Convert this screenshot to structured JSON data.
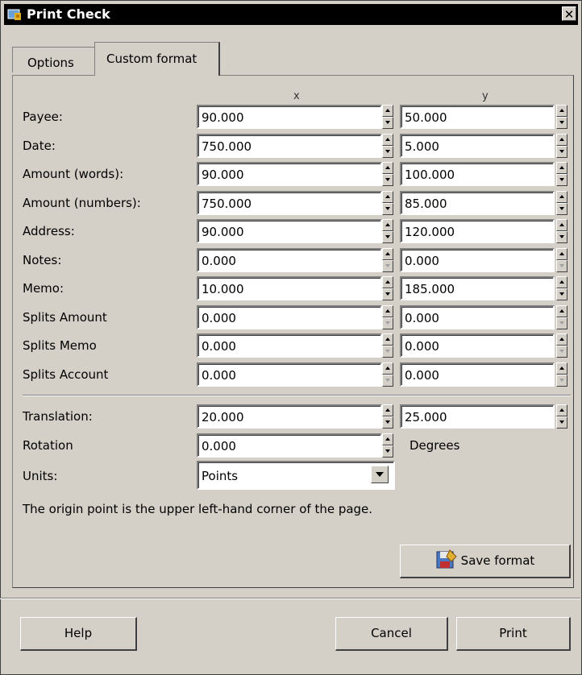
{
  "window": {
    "title": "Print Check",
    "close_glyph": "✕"
  },
  "tabs": [
    {
      "label": "Options"
    },
    {
      "label": "Custom format"
    }
  ],
  "columns": {
    "x": "x",
    "y": "y"
  },
  "rows": [
    {
      "label": "Payee:",
      "x": "90.000",
      "y": "50.000"
    },
    {
      "label": "Date:",
      "x": "750.000",
      "y": "5.000"
    },
    {
      "label": "Amount (words):",
      "x": "90.000",
      "y": "100.000"
    },
    {
      "label": "Amount (numbers):",
      "x": "750.000",
      "y": "85.000"
    },
    {
      "label": "Address:",
      "x": "90.000",
      "y": "120.000"
    },
    {
      "label": "Notes:",
      "x": "0.000",
      "y": "0.000"
    },
    {
      "label": "Memo:",
      "x": "10.000",
      "y": "185.000"
    },
    {
      "label": "Splits Amount",
      "x": "0.000",
      "y": "0.000"
    },
    {
      "label": "Splits Memo",
      "x": "0.000",
      "y": "0.000"
    },
    {
      "label": "Splits Account",
      "x": "0.000",
      "y": "0.000"
    }
  ],
  "translation": {
    "label": "Translation:",
    "x": "20.000",
    "y": "25.000"
  },
  "rotation": {
    "label": "Rotation",
    "value": "0.000",
    "unit": "Degrees"
  },
  "units": {
    "label": "Units:",
    "selected": "Points"
  },
  "note": "The origin point is the upper left-hand corner of the page.",
  "buttons": {
    "save_format": "Save format",
    "help": "Help",
    "cancel": "Cancel",
    "print": "Print"
  },
  "icons": [
    "app-icon",
    "close-icon",
    "save-icon",
    "spin-up-icon",
    "spin-down-icon",
    "dropdown-arrow-icon"
  ]
}
